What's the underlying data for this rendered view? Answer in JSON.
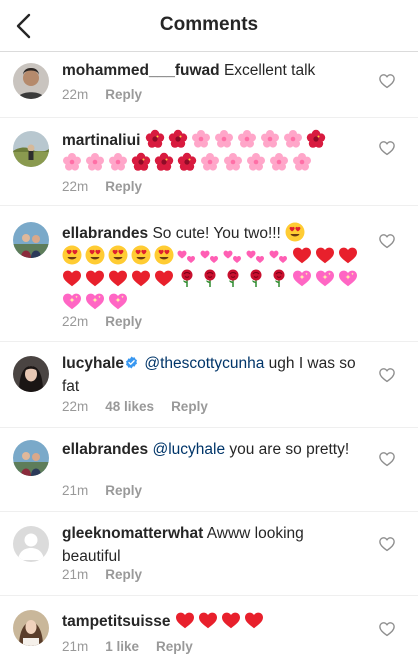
{
  "header": {
    "title": "Comments"
  },
  "comments": [
    {
      "username": "mohammed___fuwad",
      "text": " Excellent talk",
      "time": "22m",
      "reply": "Reply"
    },
    {
      "username": "martinaliui",
      "time": "22m",
      "reply": "Reply"
    },
    {
      "username": "ellabrandes",
      "text": " So cute! You two!!! ",
      "time": "22m",
      "reply": "Reply"
    },
    {
      "username": "lucyhale",
      "mention": "@thescottycunha",
      "text": " ugh I was so fat",
      "time": "22m",
      "likes": "48 likes",
      "reply": "Reply"
    },
    {
      "username": "ellabrandes",
      "mention": "@lucyhale",
      "text": " you are so pretty!",
      "time": "21m",
      "reply": "Reply"
    },
    {
      "username": "gleeknomatterwhat",
      "text": " Awww looking beautiful",
      "time": "21m",
      "reply": "Reply"
    },
    {
      "username": "tampetitsuisse",
      "time": "21m",
      "likes": "1 like",
      "reply": "Reply"
    }
  ],
  "icons": {
    "back": "chevron-left-icon",
    "like": "heart-outline-icon",
    "verified": "verified-badge-icon",
    "emoji_hibiscus": "hibiscus-emoji",
    "emoji_cherry": "cherry-blossom-emoji",
    "emoji_hearteyes": "heart-eyes-emoji",
    "emoji_twohearts": "two-hearts-emoji",
    "emoji_redheart": "red-heart-emoji",
    "emoji_rose": "rose-emoji",
    "emoji_sparkleheart": "sparkling-heart-emoji"
  },
  "colors": {
    "text": "#262626",
    "secondary": "#999999",
    "mention": "#003569",
    "divider": "#efefef",
    "verified": "#3897f0"
  }
}
